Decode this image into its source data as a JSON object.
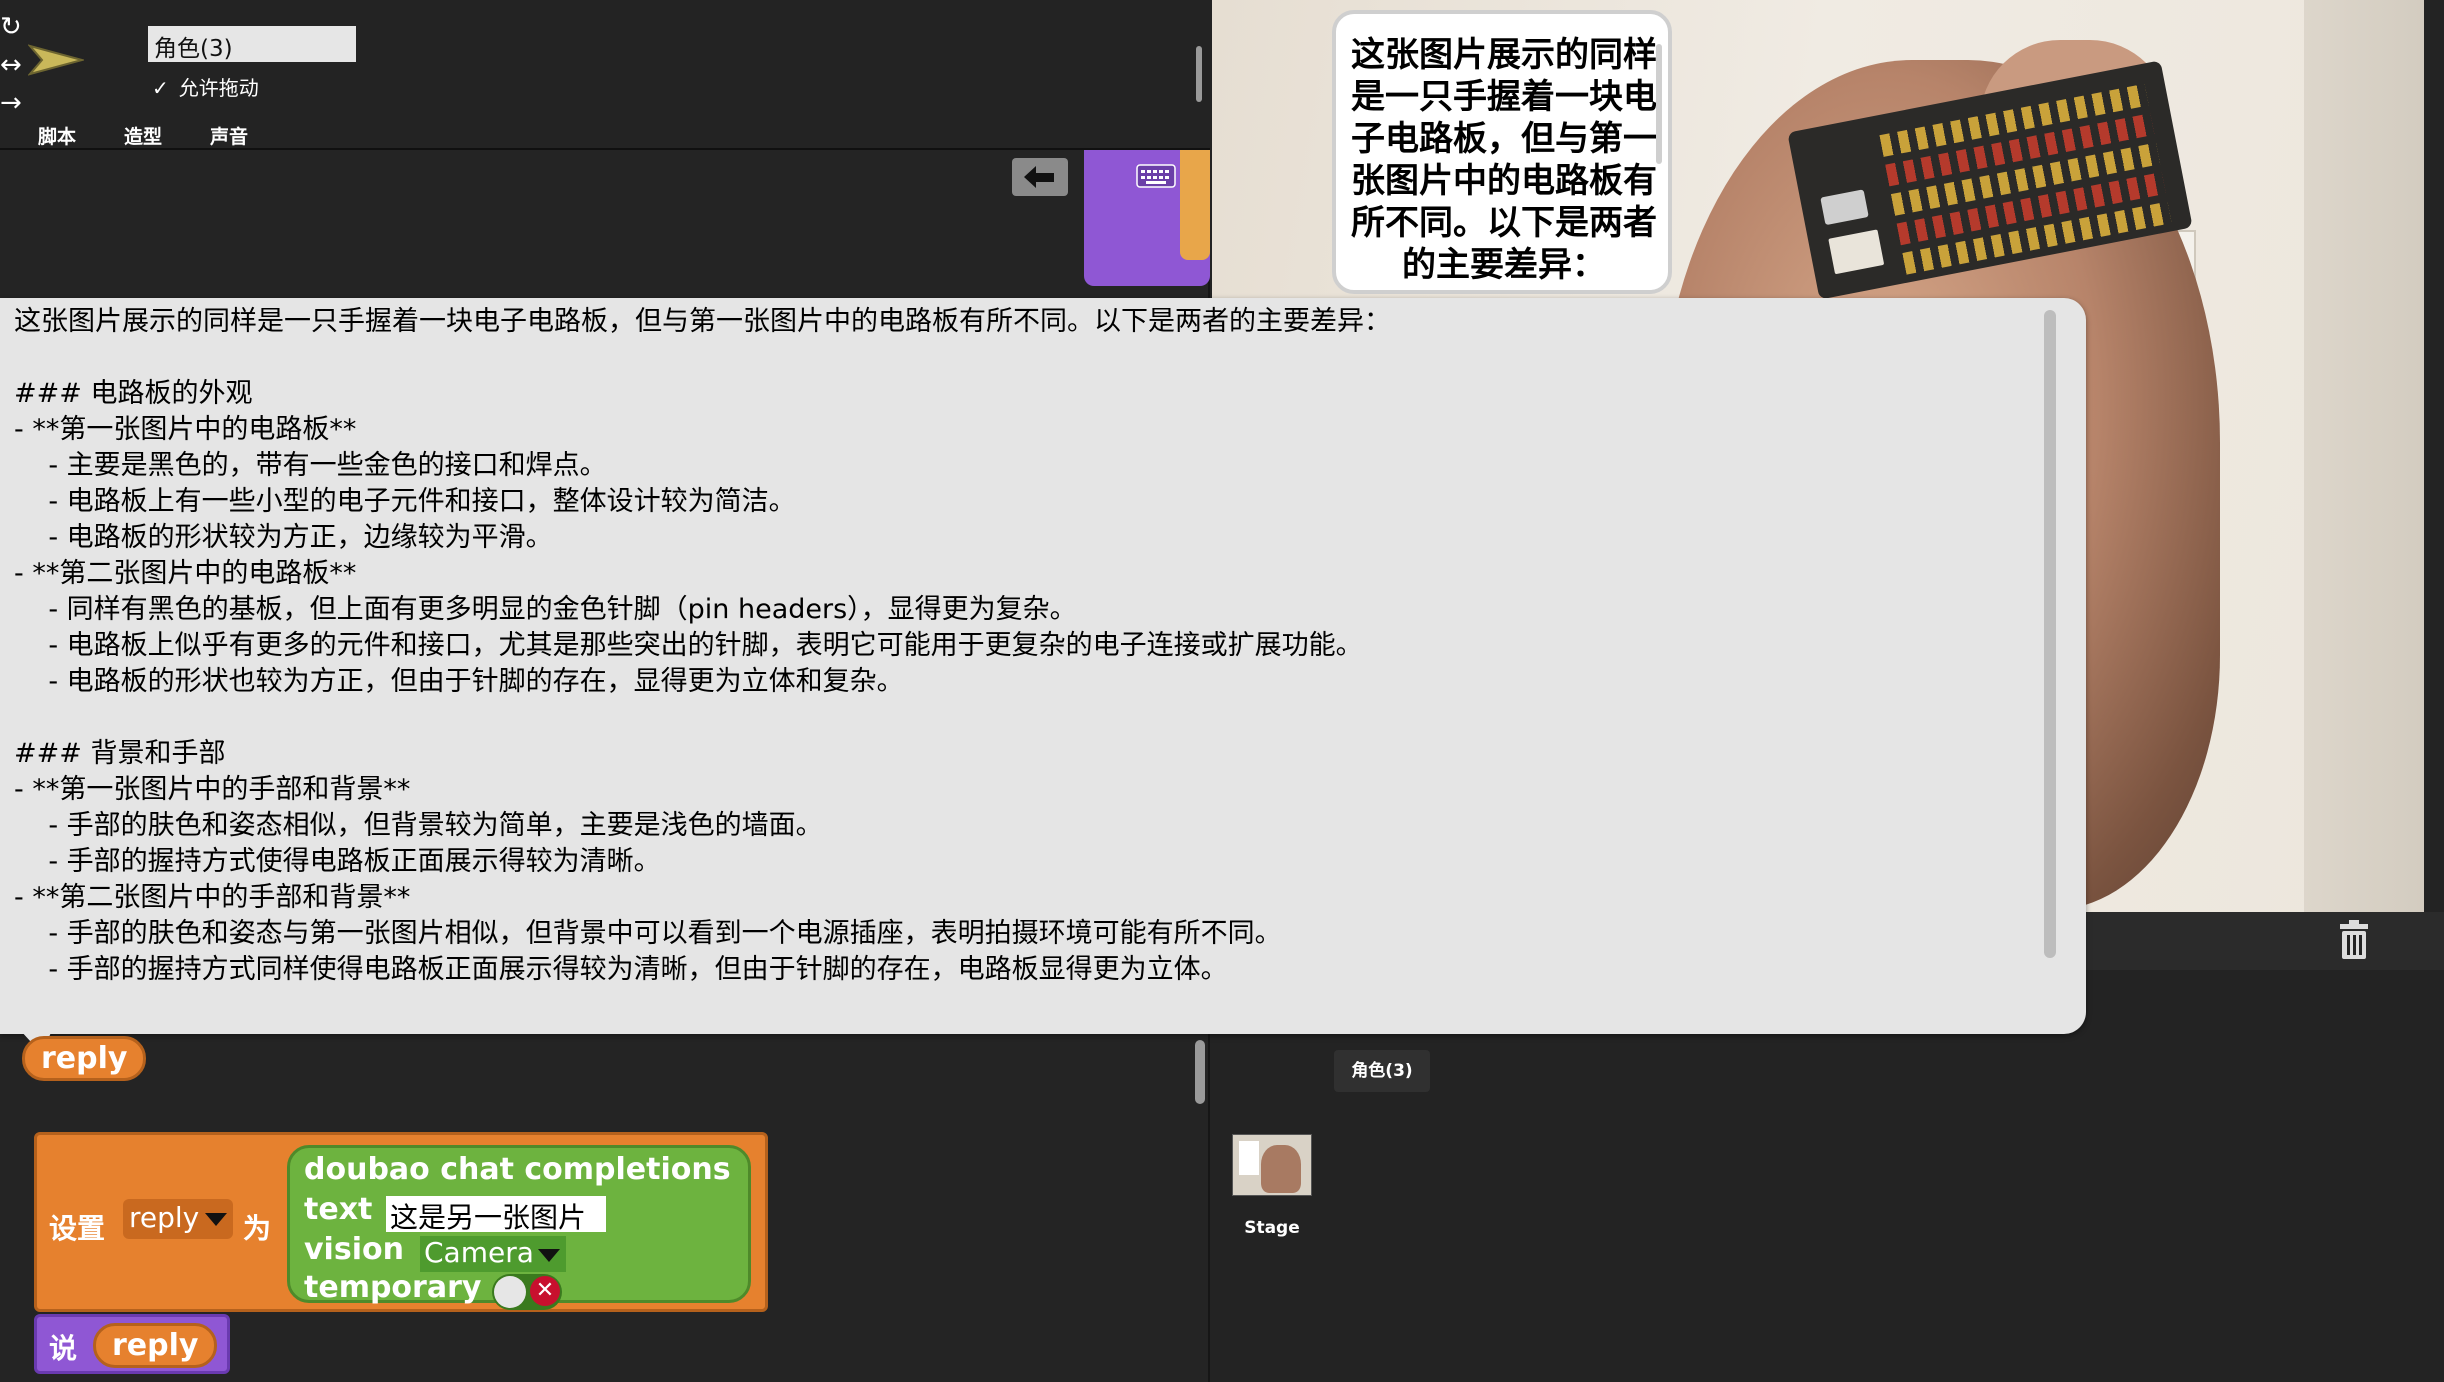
{
  "sprite": {
    "name": "角色(3)",
    "draggable_label": "允许拖动",
    "draggable_checked": true
  },
  "tabs": {
    "scripts": "脚本",
    "costumes": "造型",
    "sounds": "声音"
  },
  "stage": {
    "speech_bubble": "这张图片展示的同样是一只手握着一块电子电路板，但与第一张图片中的电路板有所不同。以下是两者的主要差异："
  },
  "result_popup": {
    "lines": [
      "这张图片展示的同样是一只手握着一块电子电路板，但与第一张图片中的电路板有所不同。以下是两者的主要差异：",
      "",
      "### 电路板的外观",
      "- **第一张图片中的电路板**",
      "    - 主要是黑色的，带有一些金色的接口和焊点。",
      "    - 电路板上有一些小型的电子元件和接口，整体设计较为简洁。",
      "    - 电路板的形状较为方正，边缘较为平滑。",
      "- **第二张图片中的电路板**",
      "    - 同样有黑色的基板，但上面有更多明显的金色针脚（pin headers），显得更为复杂。",
      "    - 电路板上似乎有更多的元件和接口，尤其是那些突出的针脚，表明它可能用于更复杂的电子连接或扩展功能。",
      "    - 电路板的形状也较为方正，但由于针脚的存在，显得更为立体和复杂。",
      "",
      "### 背景和手部",
      "- **第一张图片中的手部和背景**",
      "    - 手部的肤色和姿态相似，但背景较为简单，主要是浅色的墙面。",
      "    - 手部的握持方式使得电路板正面展示得较为清晰。",
      "- **第二张图片中的手部和背景**",
      "    - 手部的肤色和姿态与第一张图片相似，但背景中可以看到一个电源插座，表明拍摄环境可能有所不同。",
      "    - 手部的握持方式同样使得电路板正面展示得较为清晰，但由于针脚的存在，电路板显得更为立体。"
    ]
  },
  "blocks": {
    "reply_var": "reply",
    "set_label": "设置",
    "set_var": "reply",
    "to_label": "为",
    "doubao_title": "doubao chat completions",
    "text_label": "text",
    "text_value": "这是另一张图片",
    "vision_label": "vision",
    "vision_value": "Camera",
    "temporary_label": "temporary",
    "say_label": "说",
    "say_reply": "reply"
  },
  "corral": {
    "sprite_label": "角色(3)",
    "stage_label": "Stage"
  },
  "colors": {
    "orange_block": "#e6812e",
    "green_block": "#6db33f",
    "purple_block": "#8f57d4",
    "background": "#232323"
  }
}
